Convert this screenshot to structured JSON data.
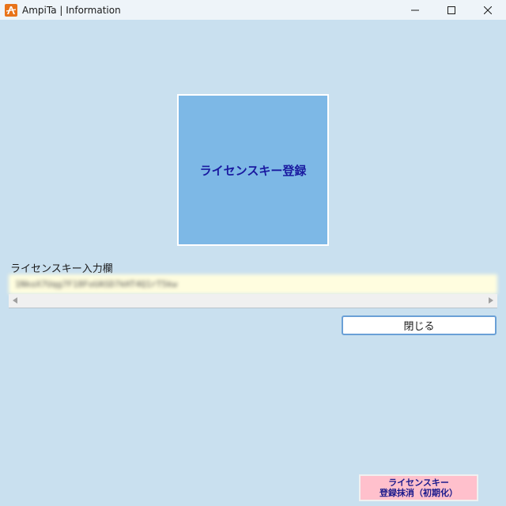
{
  "window": {
    "title": "AmpiTa | Information"
  },
  "register_button": {
    "label": "ライセンスキー登録"
  },
  "license_key": {
    "label": "ライセンスキー入力欄",
    "value": "1NkoX7Uqg7F18FoUASD7kHT4Q1rT5kw"
  },
  "close_button": {
    "label": "閉じる"
  },
  "reset_button": {
    "line1": "ライセンスキー",
    "line2": "登録抹消（初期化）"
  }
}
